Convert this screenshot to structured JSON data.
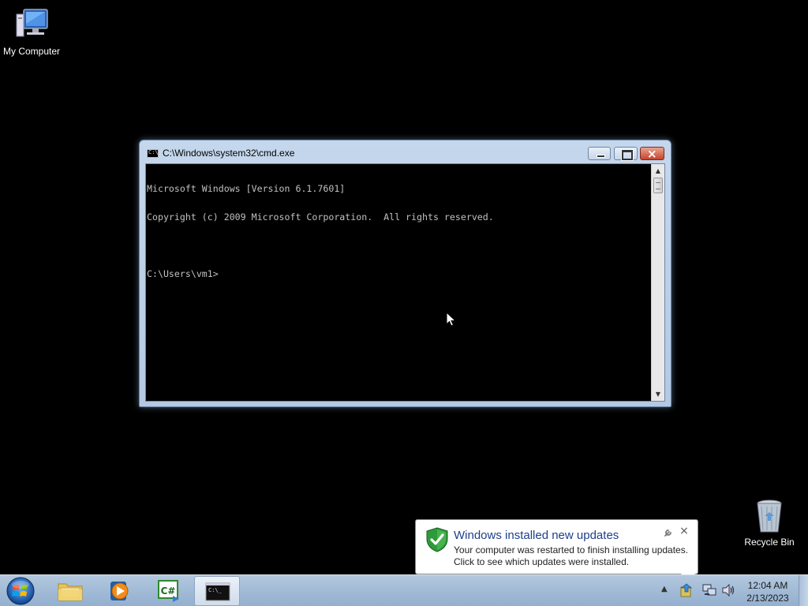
{
  "desktop": {
    "icons": [
      {
        "label": "My Computer",
        "icon": "computer-icon"
      },
      {
        "label": "Recycle Bin",
        "icon": "recycle-bin-icon"
      }
    ]
  },
  "cmd_window": {
    "title": "C:\\Windows\\system32\\cmd.exe",
    "title_icon_text": "C:\\",
    "console_lines": [
      "Microsoft Windows [Version 6.1.7601]",
      "Copyright (c) 2009 Microsoft Corporation.  All rights reserved.",
      "",
      "C:\\Users\\vm1>"
    ]
  },
  "balloon": {
    "title": "Windows installed new updates",
    "line1": "Your computer was restarted to finish installing updates.",
    "line2": "Click to see which updates were installed.",
    "close": "×"
  },
  "taskbar": {
    "pinned": [
      {
        "name": "windows-explorer",
        "icon": "folder-icon"
      },
      {
        "name": "windows-media-player",
        "icon": "media-player-icon"
      },
      {
        "name": "csharp-app",
        "icon": "csharp-icon"
      },
      {
        "name": "command-prompt",
        "icon": "cmd-icon",
        "active": true
      }
    ],
    "csharp_label": "C#",
    "cmd_icon_text": "C:\\_",
    "tray_arrow": "▲",
    "clock": {
      "time": "12:04 AM",
      "date": "2/13/2023"
    }
  },
  "colors": {
    "console_bg": "#000000",
    "console_fg": "#c0c0c0",
    "balloon_title": "#1e3f8a",
    "close_button": "#c7432c"
  }
}
